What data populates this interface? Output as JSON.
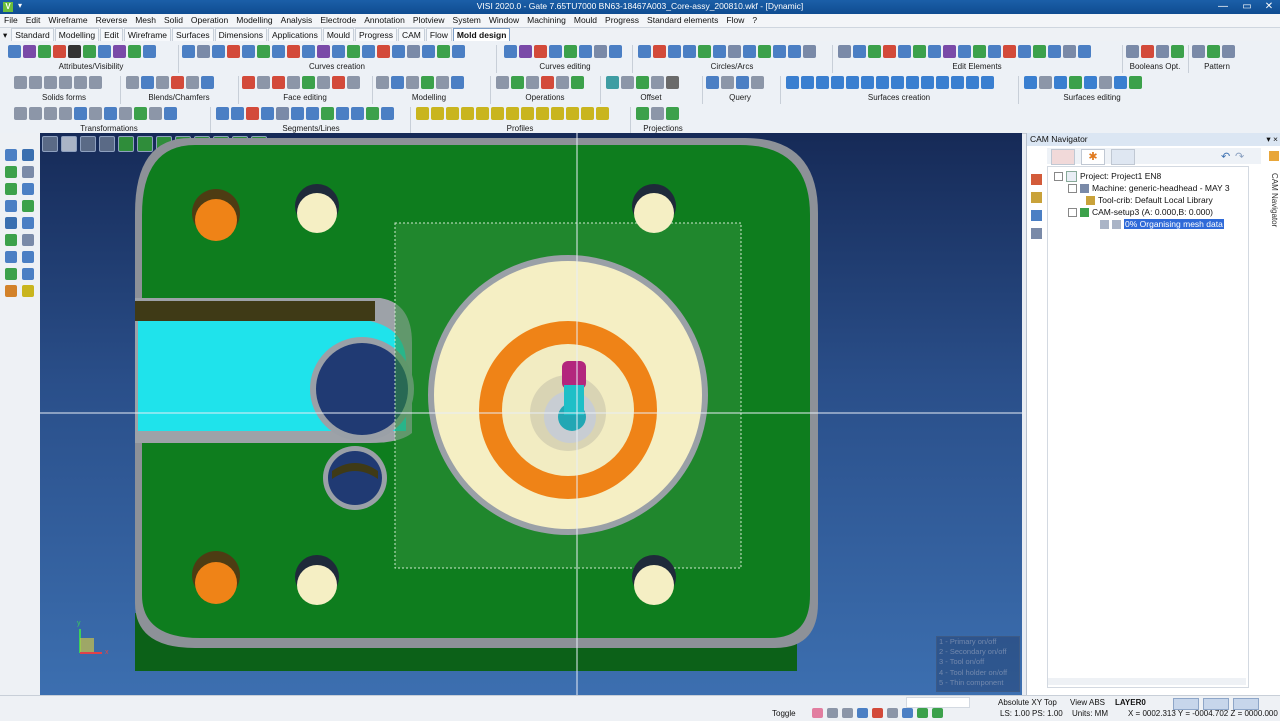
{
  "window": {
    "title": "VISI 2020.0 - Gate 7.65TU7000 BN63-18467A003_Core-assy_200810.wkf - [Dynamic]",
    "app_letter": "V",
    "quick_access": "▾"
  },
  "menu": [
    "File",
    "Edit",
    "Wireframe",
    "Reverse",
    "Mesh",
    "Solid",
    "Operation",
    "Modelling",
    "Analysis",
    "Electrode",
    "Annotation",
    "Plotview",
    "System",
    "Window",
    "Machining",
    "Mould",
    "Progress",
    "Standard elements",
    "Flow",
    "?"
  ],
  "tabs": {
    "dropdown": "▾",
    "items": [
      "Standard",
      "Modelling",
      "Edit",
      "Wireframe",
      "Surfaces",
      "Dimensions",
      "Applications",
      "Mould",
      "Progress",
      "CAM",
      "Flow",
      "Mold design"
    ],
    "active": "Mold design"
  },
  "ribbon": {
    "row1": [
      "Attributes/Visibility",
      "Curves creation",
      "Curves editing",
      "Circles/Arcs",
      "Edit Elements",
      "Booleans Opt.",
      "Pattern"
    ],
    "row2": [
      "Solids forms",
      "Blends/Chamfers",
      "Face editing",
      "Modelling",
      "Operations",
      "Offset",
      "Query",
      "Surfaces creation",
      "Surfaces editing"
    ],
    "row3": [
      "Transformations",
      "Segments/Lines",
      "Profiles",
      "Projections"
    ]
  },
  "viewport": {
    "legend": [
      "1 - Primary on/off",
      "2 - Secondary on/off",
      "3 - Tool on/off",
      "4 - Tool holder on/off",
      "5 - Thin component"
    ],
    "axis_labels": {
      "x": "x",
      "y": "y"
    }
  },
  "cam_navigator": {
    "title": "CAM Navigator",
    "side_label": "CAM Navigator",
    "pin": "▾ ×",
    "tree": {
      "project": "Project: Project1 EN8",
      "machine": "Machine: generic-headhead - MAY 3",
      "toolcrib": "Tool-crib: Default Local Library",
      "setup": "CAM-setup3 (A: 0.000,B: 0.000)",
      "status": "0% Organising mesh data"
    }
  },
  "statusbar": {
    "coord_mode": "Absolute XY Top",
    "view": "View ABS",
    "layer": "LAYER0",
    "toggle": "Toggle",
    "units": "Units: MM",
    "ls": "LS: 1.00 PS: 1.00",
    "coords": "X = 0002.313 Y = -0004.702 Z = 0000.000"
  },
  "colors": {
    "plate": "#0e7d1e",
    "cyan": "#1fe3eb",
    "orange": "#ef8317",
    "cream": "#f5efc4",
    "purple": "#b3267d"
  }
}
